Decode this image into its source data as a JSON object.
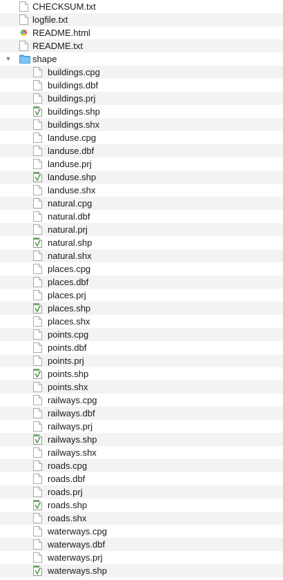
{
  "icons": {
    "document": "blank-document-icon",
    "html": "chrome-html-document-icon",
    "folder": "blue-folder-icon",
    "shape": "shapefile-document-icon"
  },
  "colors": {
    "row_alternate": "#f3f3f3",
    "folder_blue": "#5cb6ee",
    "shape_green": "#3f9a3a"
  },
  "files": [
    {
      "name": "CHECKSUM.txt",
      "icon": "document",
      "level": 0
    },
    {
      "name": "logfile.txt",
      "icon": "document",
      "level": 0
    },
    {
      "name": "README.html",
      "icon": "html",
      "level": 0
    },
    {
      "name": "README.txt",
      "icon": "document",
      "level": 0
    },
    {
      "name": "shape",
      "icon": "folder",
      "level": 0,
      "expanded": true
    },
    {
      "name": "buildings.cpg",
      "icon": "document",
      "level": 1
    },
    {
      "name": "buildings.dbf",
      "icon": "document",
      "level": 1
    },
    {
      "name": "buildings.prj",
      "icon": "document",
      "level": 1
    },
    {
      "name": "buildings.shp",
      "icon": "shape",
      "level": 1
    },
    {
      "name": "buildings.shx",
      "icon": "document",
      "level": 1
    },
    {
      "name": "landuse.cpg",
      "icon": "document",
      "level": 1
    },
    {
      "name": "landuse.dbf",
      "icon": "document",
      "level": 1
    },
    {
      "name": "landuse.prj",
      "icon": "document",
      "level": 1
    },
    {
      "name": "landuse.shp",
      "icon": "shape",
      "level": 1
    },
    {
      "name": "landuse.shx",
      "icon": "document",
      "level": 1
    },
    {
      "name": "natural.cpg",
      "icon": "document",
      "level": 1
    },
    {
      "name": "natural.dbf",
      "icon": "document",
      "level": 1
    },
    {
      "name": "natural.prj",
      "icon": "document",
      "level": 1
    },
    {
      "name": "natural.shp",
      "icon": "shape",
      "level": 1
    },
    {
      "name": "natural.shx",
      "icon": "document",
      "level": 1
    },
    {
      "name": "places.cpg",
      "icon": "document",
      "level": 1
    },
    {
      "name": "places.dbf",
      "icon": "document",
      "level": 1
    },
    {
      "name": "places.prj",
      "icon": "document",
      "level": 1
    },
    {
      "name": "places.shp",
      "icon": "shape",
      "level": 1
    },
    {
      "name": "places.shx",
      "icon": "document",
      "level": 1
    },
    {
      "name": "points.cpg",
      "icon": "document",
      "level": 1
    },
    {
      "name": "points.dbf",
      "icon": "document",
      "level": 1
    },
    {
      "name": "points.prj",
      "icon": "document",
      "level": 1
    },
    {
      "name": "points.shp",
      "icon": "shape",
      "level": 1
    },
    {
      "name": "points.shx",
      "icon": "document",
      "level": 1
    },
    {
      "name": "railways.cpg",
      "icon": "document",
      "level": 1
    },
    {
      "name": "railways.dbf",
      "icon": "document",
      "level": 1
    },
    {
      "name": "railways.prj",
      "icon": "document",
      "level": 1
    },
    {
      "name": "railways.shp",
      "icon": "shape",
      "level": 1
    },
    {
      "name": "railways.shx",
      "icon": "document",
      "level": 1
    },
    {
      "name": "roads.cpg",
      "icon": "document",
      "level": 1
    },
    {
      "name": "roads.dbf",
      "icon": "document",
      "level": 1
    },
    {
      "name": "roads.prj",
      "icon": "document",
      "level": 1
    },
    {
      "name": "roads.shp",
      "icon": "shape",
      "level": 1
    },
    {
      "name": "roads.shx",
      "icon": "document",
      "level": 1
    },
    {
      "name": "waterways.cpg",
      "icon": "document",
      "level": 1
    },
    {
      "name": "waterways.dbf",
      "icon": "document",
      "level": 1
    },
    {
      "name": "waterways.prj",
      "icon": "document",
      "level": 1
    },
    {
      "name": "waterways.shp",
      "icon": "shape",
      "level": 1
    }
  ]
}
